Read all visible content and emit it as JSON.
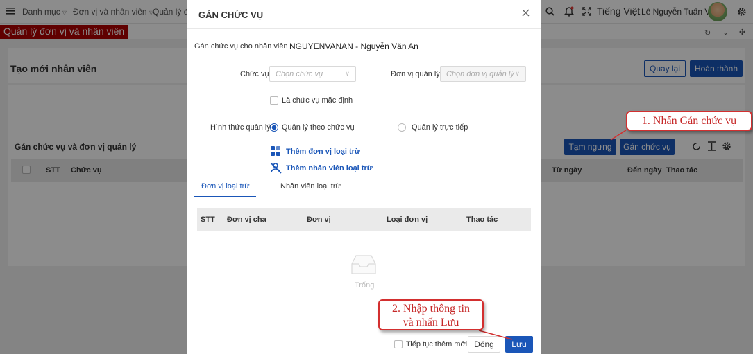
{
  "topbar": {
    "crumbs": [
      "Danh mục",
      "Đơn vị và nhân viên",
      "Quản lý đơ"
    ],
    "language": "Tiếng Việt",
    "user_name": "Lê Nguyễn Tuấn Vũ"
  },
  "section_title": "Quản lý đơn vị và nhân viên",
  "page": {
    "title": "Tạo mới nhân viên",
    "back_button": "Quay lại",
    "finish_button": "Hoàn thành",
    "partial_text": "ý",
    "assign_section_title": "Gán chức vụ và đơn vị quản lý",
    "pause_button": "Tạm ngưng",
    "assign_button": "Gán chức vụ",
    "table_headers": [
      "STT",
      "Chức vụ",
      "Từ ngày",
      "Đến ngày",
      "Thao tác"
    ]
  },
  "modal": {
    "title": "GÁN CHỨC VỤ",
    "employee_label": "Gán chức vụ cho nhân viên :",
    "employee_value": "NGUYENVANAN - Nguyễn Văn An",
    "position_label": "Chức vụ",
    "position_placeholder": "Chọn chức vụ",
    "unit_label": "Đơn vị quản lý",
    "unit_placeholder": "Chọn đơn vị quản lý",
    "default_checkbox_label": "Là chức vụ mặc định",
    "manage_type_label": "Hình thức quản lý",
    "radio_by_position": "Quản lý theo chức vụ",
    "radio_direct": "Quản lý trực tiếp",
    "add_excluded_unit": "Thêm đơn vị loại trừ",
    "add_excluded_employee": "Thêm nhân viên loại trừ",
    "tabs": [
      "Đơn vị loại trừ",
      "Nhân viên loại trừ"
    ],
    "table_headers": [
      "STT",
      "Đơn vị cha",
      "Đơn vị",
      "Loại đơn vị",
      "Thao tác"
    ],
    "empty_text": "Trống",
    "continue_label": "Tiếp tục thêm mới",
    "close_button": "Đóng",
    "save_button": "Lưu"
  },
  "callouts": {
    "step1": "1. Nhấn Gán chức vụ",
    "step2_line1": "2. Nhập thông tin",
    "step2_line2": "và nhấn Lưu"
  },
  "colors": {
    "primary": "#1a56b8",
    "section_red": "#b00000",
    "callout_red": "#d32f2f"
  }
}
